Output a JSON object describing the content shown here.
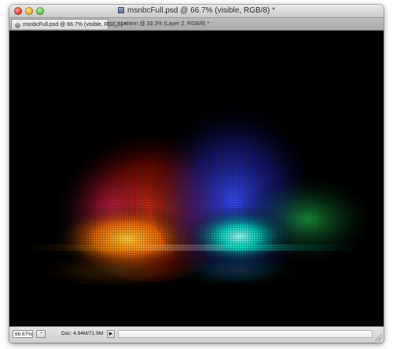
{
  "window": {
    "title": "msnbcFull.psd @ 66.7% (visible, RGB/8) *",
    "title_icon": "document-icon"
  },
  "tabs": [
    {
      "label": "msnbcFull.psd @ 66.7% (visible, RGB/8) *",
      "active": true
    },
    {
      "label": "pattern @ 33.3% (Layer 2, RGB/8) *",
      "active": false
    }
  ],
  "canvas": {
    "background": "#000000",
    "glow_colors": [
      "#ff2a00",
      "#ffb000",
      "#00ffd0",
      "#1e2bff",
      "#ff00a0"
    ]
  },
  "statusbar": {
    "zoom": "66.67%",
    "doc_info": "Doc: 4.94M/71.9M",
    "menu_arrow": "▶"
  }
}
